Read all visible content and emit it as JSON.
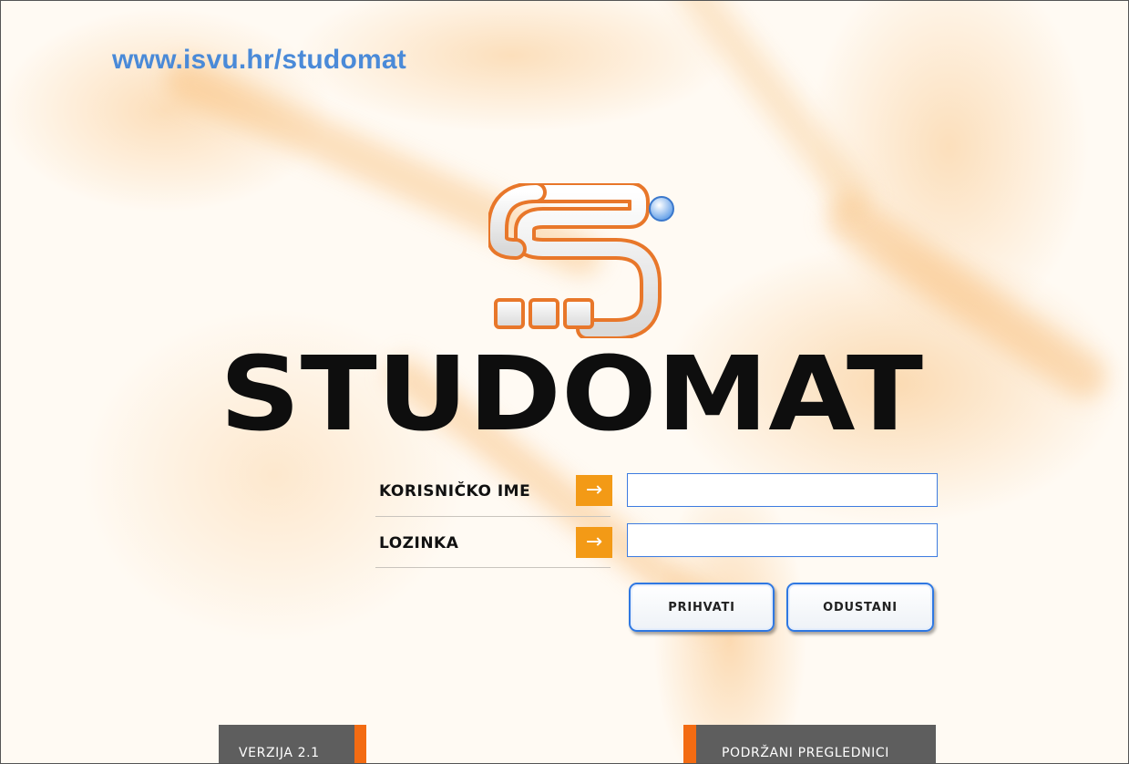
{
  "header": {
    "site_url": "www.isvu.hr/studomat"
  },
  "logo": {
    "wordmark": "STUDOMAT",
    "mark_icon": "studomat-s-logo-icon"
  },
  "login": {
    "username_label": "KORISNIČKO IME",
    "password_label": "LOZINKA",
    "arrow_icon": "→",
    "username_value": "",
    "password_value": "",
    "accept_label": "PRIHVATI",
    "cancel_label": "ODUSTANI"
  },
  "footer": {
    "version_label": "VERZIJA 2.1",
    "browsers_label": "PODRŽANI PREGLEDNICI"
  },
  "colors": {
    "accent_orange": "#f39a16",
    "tab_orange": "#f36b12",
    "link_blue": "#4a8ad8",
    "button_border_blue": "#2f78e2",
    "tab_gray": "#5e5e5e"
  }
}
